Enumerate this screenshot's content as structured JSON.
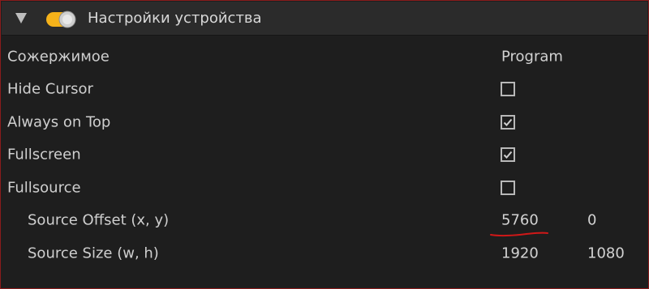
{
  "header": {
    "title": "Настройки устройства"
  },
  "column_header": {
    "name": "Сожержимое",
    "value": "Program"
  },
  "rows": {
    "hide_cursor": {
      "label": "Hide Cursor",
      "checked": false
    },
    "always_on_top": {
      "label": "Always on Top",
      "checked": true
    },
    "fullscreen": {
      "label": "Fullscreen",
      "checked": true
    },
    "fullsource": {
      "label": "Fullsource",
      "checked": false
    },
    "source_offset": {
      "label": "Source Offset (x, y)",
      "x": "5760",
      "y": "0"
    },
    "source_size": {
      "label": "Source Size (w, h)",
      "w": "1920",
      "h": "1080"
    }
  },
  "colors": {
    "background": "#1e1e1e",
    "header_bar": "#2b2b2b",
    "toggle_accent": "#f5b21a",
    "annotation_underline": "#d01818"
  },
  "icons": {
    "collapse": "triangle-down-icon",
    "toggle": "toggle-icon"
  }
}
